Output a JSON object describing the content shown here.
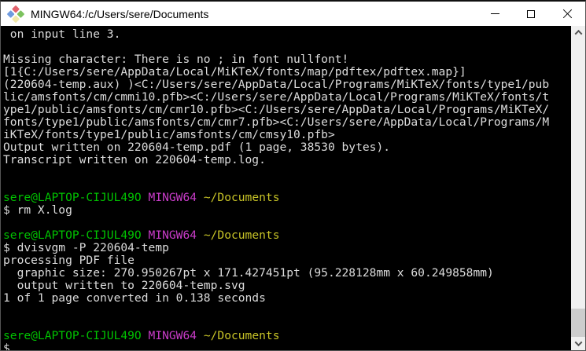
{
  "window": {
    "title": "MINGW64:/c/Users/sere/Documents",
    "app_icon": "msys2-diamond-icon",
    "controls": [
      {
        "name": "minimize",
        "icon": "minimize-icon"
      },
      {
        "name": "maximize",
        "icon": "maximize-icon"
      },
      {
        "name": "close",
        "icon": "close-icon"
      }
    ],
    "icon_colors": {
      "top": "#e2636d",
      "right": "#7cc25e",
      "bottom": "#f2e9a9",
      "left": "#6f9bdf"
    }
  },
  "colors": {
    "background": "#000000",
    "fg": "#dcdcdc",
    "green": "#00c200",
    "magenta": "#c93cc9",
    "yellow": "#c7c327",
    "titlebar_bg": "#ffffff",
    "title_text": "#000000",
    "scrollbar_track": "#f0f0f0",
    "scrollbar_thumb": "#cdcdcd"
  },
  "prompt": {
    "user_host": "sere@LAPTOP-CIJUL49O",
    "msystem": "MINGW64",
    "path": "~/Documents"
  },
  "terminal": {
    "lines": [
      {
        "text": " on input line 3."
      },
      {
        "text": ""
      },
      {
        "text": "Missing character: There is no ; in font nullfont!"
      },
      {
        "text": "[1{C:/Users/sere/AppData/Local/MiKTeX/fonts/map/pdftex/pdftex.map}]"
      },
      {
        "text": "(220604-temp.aux) )<C:/Users/sere/AppData/Local/Programs/MiKTeX/fonts/type1/pub"
      },
      {
        "text": "lic/amsfonts/cm/cmmi10.pfb><C:/Users/sere/AppData/Local/Programs/MiKTeX/fonts/t"
      },
      {
        "text": "ype1/public/amsfonts/cm/cmr10.pfb><C:/Users/sere/AppData/Local/Programs/MiKTeX/"
      },
      {
        "text": "fonts/type1/public/amsfonts/cm/cmr7.pfb><C:/Users/sere/AppData/Local/Programs/M"
      },
      {
        "text": "iKTeX/fonts/type1/public/amsfonts/cm/cmsy10.pfb>"
      },
      {
        "text": "Output written on 220604-temp.pdf (1 page, 38530 bytes)."
      },
      {
        "text": "Transcript written on 220604-temp.log."
      },
      {
        "text": ""
      },
      {
        "text": ""
      },
      {
        "prompt": true
      },
      {
        "text": "$ rm X.log"
      },
      {
        "text": ""
      },
      {
        "prompt": true
      },
      {
        "text": "$ dvisvgm -P 220604-temp"
      },
      {
        "text": "processing PDF file"
      },
      {
        "text": "  graphic size: 270.950267pt x 171.427451pt (95.228128mm x 60.249858mm)"
      },
      {
        "text": "  output written to 220604-temp.svg"
      },
      {
        "text": "1 of 1 page converted in 0.138 seconds"
      },
      {
        "text": ""
      },
      {
        "text": ""
      },
      {
        "prompt": true
      },
      {
        "text": "$ "
      }
    ]
  },
  "scrollbar": {
    "up_icon": "chevron-up",
    "down_icon": "chevron-down"
  }
}
